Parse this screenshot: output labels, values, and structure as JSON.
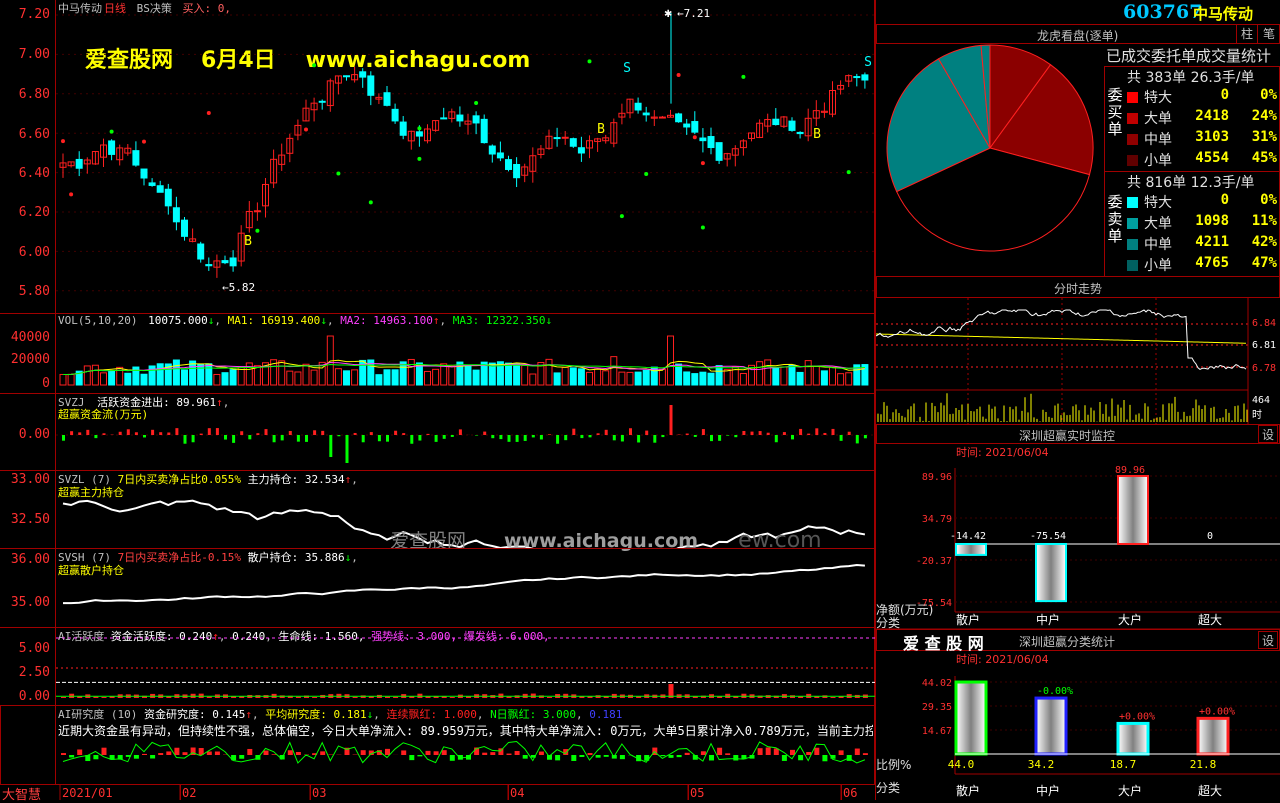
{
  "header": {
    "stock_name": "中马传动",
    "period": "日线",
    "indicator": "BS决策",
    "buy_text": "买入: 0,"
  },
  "watermark": {
    "site": "爱查股网",
    "date": "6月4日",
    "url": "www.aichagu.com",
    "mid_site": "爱查股网",
    "mid_url": "www.aichagu.com",
    "mid_tail": "ew.com"
  },
  "price_axis": [
    "7.20",
    "7.00",
    "6.80",
    "6.60",
    "6.40",
    "6.20",
    "6.00",
    "5.80"
  ],
  "annotations": {
    "high": "7.21",
    "low": "5.82",
    "b": "B",
    "s": "S"
  },
  "vol": {
    "title": "VOL(5,10,20)",
    "value": "10075.000",
    "ma1": "MA1: 16919.400",
    "ma2": "MA2: 14963.100",
    "ma3": "MA3: 12322.350",
    "axis": [
      "40000",
      "20000",
      "0"
    ]
  },
  "svzj": {
    "title": "SVZJ",
    "desc": "活跃资金进出: 89.961",
    "sub": "超赢资金流(万元)",
    "axis": "0.00"
  },
  "svzl": {
    "title": "SVZL (7)",
    "desc": "7日内买卖净占比0.055%",
    "hold": "主力持仓: 32.534",
    "sub": "超赢主力持仓",
    "axis": [
      "33.00",
      "32.50"
    ]
  },
  "svsh": {
    "title": "SVSH (7)",
    "desc": "7日内买卖净占比-0.15%",
    "hold": "散户持仓: 35.886",
    "sub": "超赢散户持仓",
    "axis": [
      "36.00",
      "35.00"
    ]
  },
  "ai": {
    "title": "AI活跃度",
    "desc": "资金活跃度: 0.240",
    "v2": "0.240",
    "life": "生命线: 1.560,",
    "strong": "强势线: 3.000,",
    "burst": "爆发线: 6.000,",
    "axis": [
      "5.00",
      "2.50",
      "0.00"
    ]
  },
  "research": {
    "title": "AI研究度 (10)",
    "v1": "资金研究度: 0.145",
    "v2": "平均研究度: 0.181",
    "v3": "连续飘红: 1.000",
    "v4": "N日飘红: 3.000",
    "v5": "0.181",
    "text": "近期大资金虽有异动，但持续性不强，总体偏空，今日大单净流入: 89.959万元，其中特大单净流入: 0万元，大单5日累计净入0.789万元，当前主力控盘弱",
    "badge": "大智慧"
  },
  "x_axis": [
    "2021/01",
    "02",
    "03",
    "04",
    "05",
    "06"
  ],
  "right": {
    "code": "603767",
    "name": "中马传动",
    "tab1": "柱",
    "tab2": "笔",
    "dragon_title": "龙虎看盘(逐单)",
    "stats_title": "已成交委托单成交量统计",
    "buy_total": "共 383单 26.3手/单",
    "sell_total": "共 816单 12.3手/单",
    "buy_label": "委买单",
    "sell_label": "委卖单",
    "buy_rows": [
      {
        "name": "特大",
        "vol": "0",
        "pct": "0%",
        "color": "#ff0000"
      },
      {
        "name": "大单",
        "vol": "2418",
        "pct": "24%",
        "color": "#c00000"
      },
      {
        "name": "中单",
        "vol": "3103",
        "pct": "31%",
        "color": "#900000"
      },
      {
        "name": "小单",
        "vol": "4554",
        "pct": "45%",
        "color": "#600000"
      }
    ],
    "sell_rows": [
      {
        "name": "特大",
        "vol": "0",
        "pct": "0%",
        "color": "#00ffff"
      },
      {
        "name": "大单",
        "vol": "1098",
        "pct": "11%",
        "color": "#00a0a0"
      },
      {
        "name": "中单",
        "vol": "4211",
        "pct": "42%",
        "color": "#008080"
      },
      {
        "name": "小单",
        "vol": "4765",
        "pct": "47%",
        "color": "#006060"
      }
    ],
    "intraday_title": "分时走势",
    "intraday_axis": [
      "6.84",
      "6.81",
      "6.78"
    ],
    "intraday_vol_axis": [
      "464",
      "时"
    ],
    "monitor_title": "深圳超赢实时监控",
    "monitor_time": "时间: 2021/06/04",
    "monitor_axis": [
      "89.96",
      "34.79",
      "-20.37",
      "-75.54"
    ],
    "monitor_unit": "净额(万元)",
    "monitor_cat_label": "分类",
    "monitor_bars": [
      {
        "name": "散户",
        "value": "-14.42"
      },
      {
        "name": "中户",
        "value": "-75.54"
      },
      {
        "name": "大户",
        "value": "89.96"
      },
      {
        "name": "超大",
        "value": "0"
      }
    ],
    "class_site": "爱 查 股 网",
    "class_title": "深圳超赢分类统计",
    "class_time": "时间: 2021/06/04",
    "class_axis": [
      "44.02",
      "29.35",
      "14.67"
    ],
    "class_ratio_label": "比例%",
    "class_cat_label": "分类",
    "class_bars": [
      {
        "name": "散户",
        "value": "44.0",
        "chg": ""
      },
      {
        "name": "中户",
        "value": "34.2",
        "chg": "-0.00%"
      },
      {
        "name": "大户",
        "value": "18.7",
        "chg": "+0.00%"
      },
      {
        "name": "超大",
        "value": "21.8",
        "chg": "+0.00%"
      }
    ],
    "set_label": "设"
  },
  "colors": {
    "up": "#ff2020",
    "down": "#00ffff",
    "frame": "#a00000",
    "pie_buy": "#8b0000",
    "pie_sell": "#008080"
  }
}
